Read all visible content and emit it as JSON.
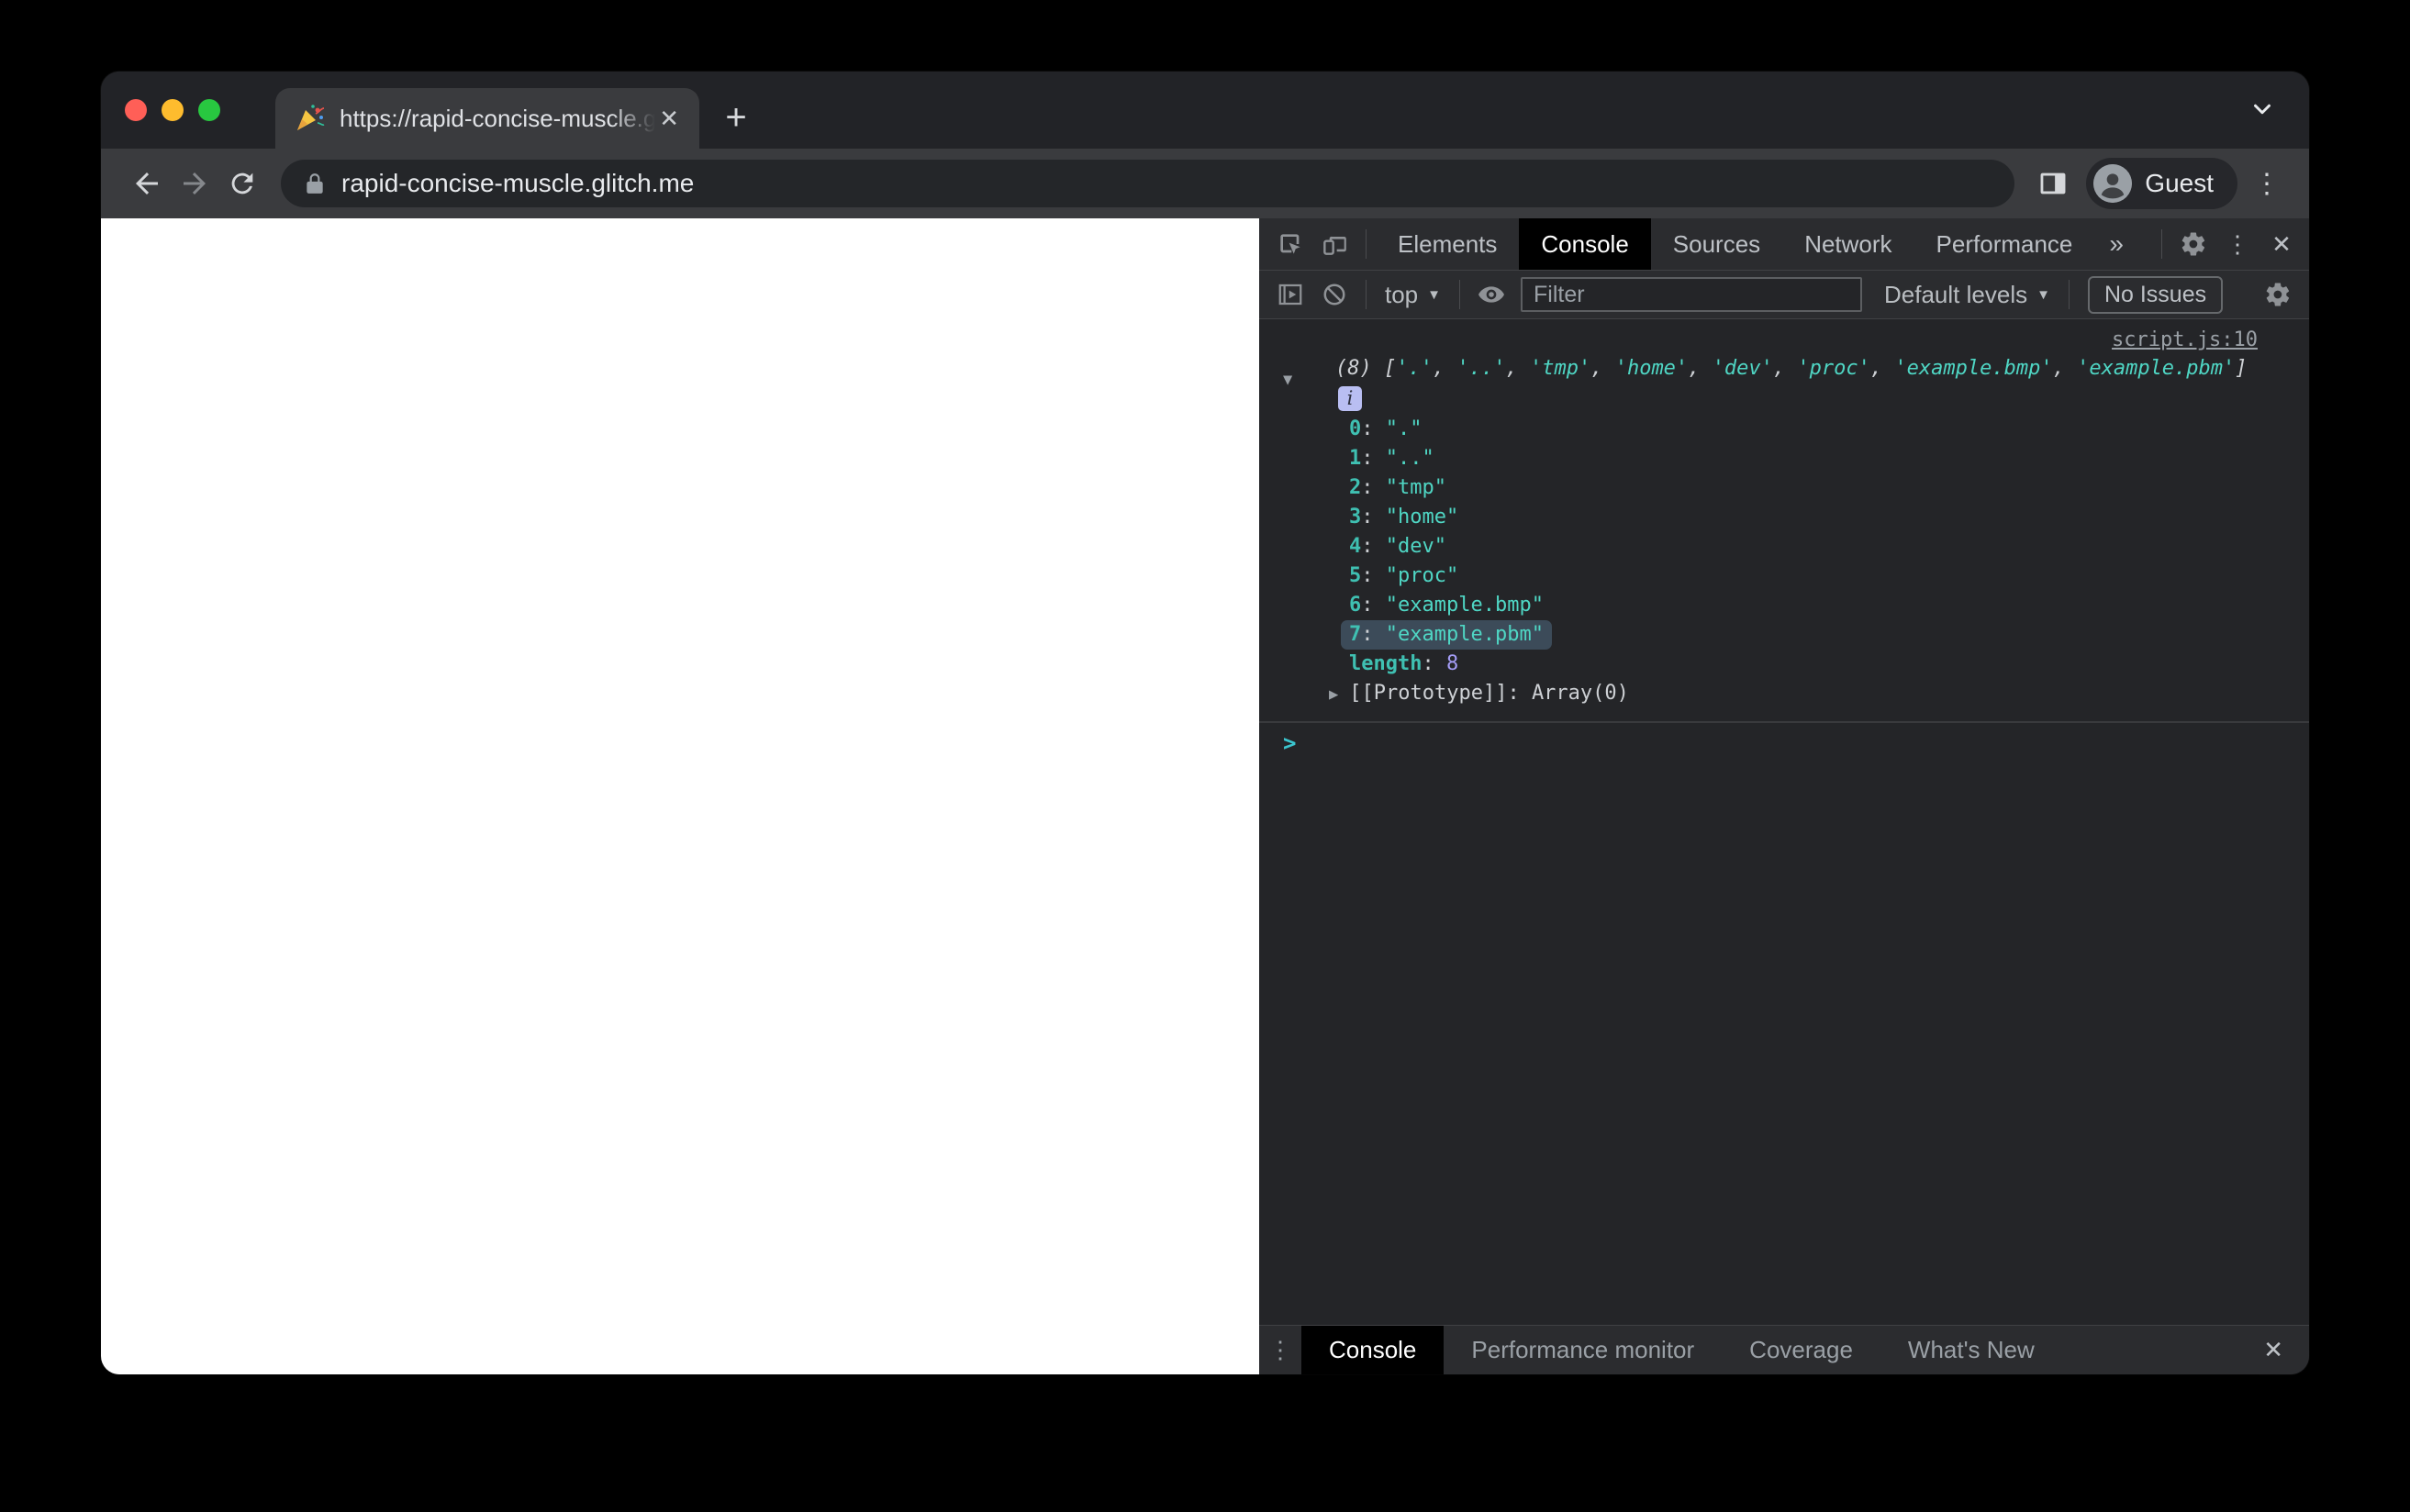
{
  "browser": {
    "tab_title": "https://rapid-concise-muscle.g",
    "url": "rapid-concise-muscle.glitch.me",
    "profile_label": "Guest",
    "new_tab_label": "+",
    "tab_close_label": "✕"
  },
  "devtools": {
    "tabs": {
      "labels": [
        "Elements",
        "Console",
        "Sources",
        "Network",
        "Performance"
      ],
      "active": "Console",
      "more_label": "»"
    },
    "toolbar": {
      "context": "top",
      "filter_placeholder": "Filter",
      "levels_label": "Default levels",
      "issues_label": "No Issues"
    },
    "console": {
      "source_link": "script.js:10",
      "array_count": "(8)",
      "array_items": [
        ".",
        "..",
        "tmp",
        "home",
        "dev",
        "proc",
        "example.bmp",
        "example.pbm"
      ],
      "highlighted_index": 7,
      "info_badge": "i",
      "length_label": "length",
      "length_value": "8",
      "prototype_label": "[[Prototype]]",
      "prototype_value": "Array(0)",
      "prompt": ">",
      "expander_open": "▼",
      "expander_closed": "▶"
    },
    "drawer": {
      "tabs": [
        "Console",
        "Performance monitor",
        "Coverage",
        "What's New"
      ],
      "active": "Console",
      "close_label": "✕"
    }
  },
  "colors": {
    "string": "#4fd6c4",
    "property": "#3fc0b2",
    "number": "#a49df6",
    "prompt": "#3bc6cf",
    "highlight": "#3c4b59",
    "info_badge": "#b9bef2",
    "link": "#9aa0a6",
    "traffic_red": "#ff5f57",
    "traffic_yellow": "#febc2e",
    "traffic_green": "#28c840"
  }
}
